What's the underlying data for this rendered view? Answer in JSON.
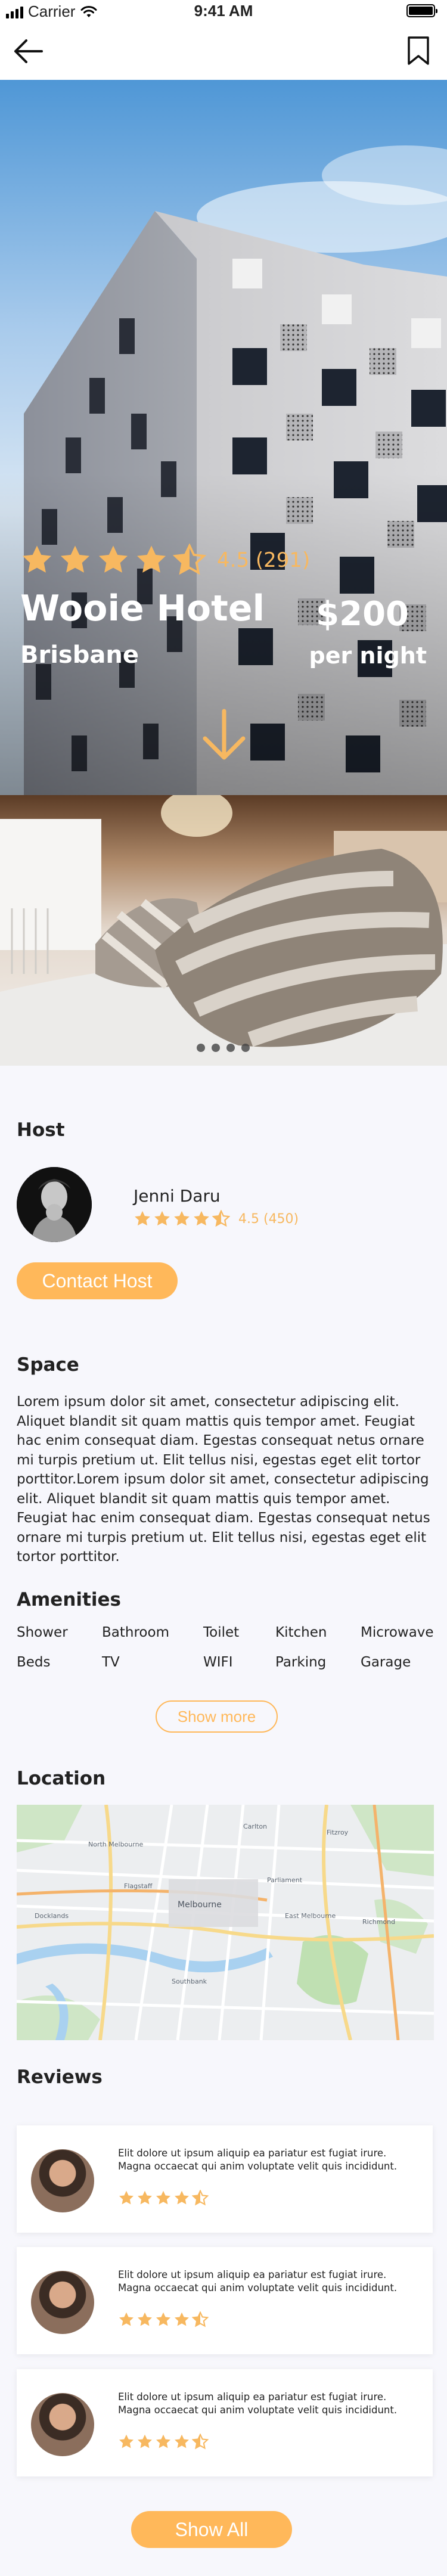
{
  "status_bar": {
    "carrier": "Carrier",
    "time": "9:41 AM"
  },
  "nav": {
    "back_icon": "arrow-left-icon",
    "bookmark_icon": "bookmark-icon"
  },
  "hotel": {
    "rating_value": 4.5,
    "rating_text": "4.5 (291)",
    "name": "Wooie Hotel",
    "city": "Brisbane",
    "price": "$200",
    "price_unit": "per night"
  },
  "gallery": {
    "slide_count": 4
  },
  "host": {
    "section_title": "Host",
    "name": "Jenni Daru",
    "rating_value": 4.5,
    "rating_text": "4.5 (450)",
    "contact_label": "Contact Host"
  },
  "space": {
    "section_title": "Space",
    "description": "Lorem ipsum dolor sit amet, consectetur adipiscing elit. Aliquet blandit sit quam mattis quis tempor amet. Feugiat hac enim consequat diam. Egestas consequat netus ornare mi turpis pretium ut. Elit tellus nisi, egestas eget elit tortor porttitor.Lorem ipsum dolor sit amet, consectetur adipiscing elit. Aliquet blandit sit quam mattis quis tempor amet. Feugiat hac enim consequat diam. Egestas consequat netus ornare mi turpis pretium ut. Elit tellus nisi, egestas eget elit tortor porttitor."
  },
  "amenities": {
    "section_title": "Amenities",
    "items": [
      "Shower",
      "Bathroom",
      "Toilet",
      "Kitchen",
      "Microwave",
      "Beds",
      "TV",
      "WIFI",
      "Parking",
      "Garage"
    ],
    "show_more_label": "Show more"
  },
  "location": {
    "section_title": "Location",
    "map_labels": [
      "Melbourne",
      "Docklands",
      "Southbank",
      "Carlton",
      "Fitzroy",
      "Richmond",
      "North Melbourne",
      "East Melbourne",
      "Flagstaff",
      "Parliament"
    ]
  },
  "reviews": {
    "section_title": "Reviews",
    "items": [
      {
        "text": "Elit dolore ut ipsum aliquip ea pariatur est fugiat irure. Magna occaecat qui anim voluptate velit quis incididunt.",
        "rating": 4.5
      },
      {
        "text": "Elit dolore ut ipsum aliquip ea pariatur est fugiat irure. Magna occaecat qui anim voluptate velit quis incididunt.",
        "rating": 4.5
      },
      {
        "text": "Elit dolore ut ipsum aliquip ea pariatur est fugiat irure. Magna occaecat qui anim voluptate velit quis incididunt.",
        "rating": 4.5
      }
    ],
    "show_all_label": "Show All"
  },
  "colors": {
    "accent": "#FFB85A",
    "star": "#F7B860",
    "background": "#F7F7FC"
  }
}
